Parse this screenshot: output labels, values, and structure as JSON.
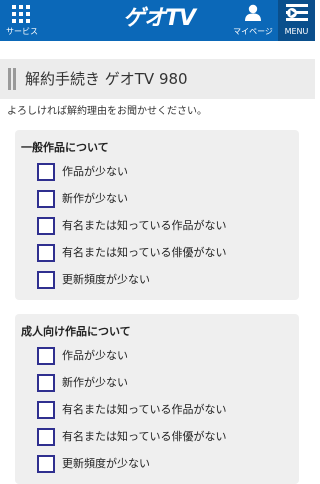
{
  "header": {
    "services_label": "サービス",
    "logo_text": "ゲオTV",
    "mypage_label": "マイページ",
    "menu_label": "MENU",
    "icons": {
      "services": "grid-icon",
      "mypage": "user-icon",
      "menu": "menu-icon"
    },
    "colors": {
      "bar": "#0b68b8",
      "menu_bg": "#0a4f8c"
    }
  },
  "page_title": "解約手続き ゲオTV 980",
  "intro_text": "よろしければ解約理由をお聞かせください。",
  "sections": [
    {
      "title": "一般作品について",
      "options": [
        {
          "label": "作品が少ない",
          "checked": false
        },
        {
          "label": "新作が少ない",
          "checked": false
        },
        {
          "label": "有名または知っている作品がない",
          "checked": false
        },
        {
          "label": "有名または知っている俳優がない",
          "checked": false
        },
        {
          "label": "更新頻度が少ない",
          "checked": false
        }
      ]
    },
    {
      "title": "成人向け作品について",
      "options": [
        {
          "label": "作品が少ない",
          "checked": false
        },
        {
          "label": "新作が少ない",
          "checked": false
        },
        {
          "label": "有名または知っている作品がない",
          "checked": false
        },
        {
          "label": "有名または知っている俳優がない",
          "checked": false
        },
        {
          "label": "更新頻度が少ない",
          "checked": false
        }
      ]
    }
  ]
}
